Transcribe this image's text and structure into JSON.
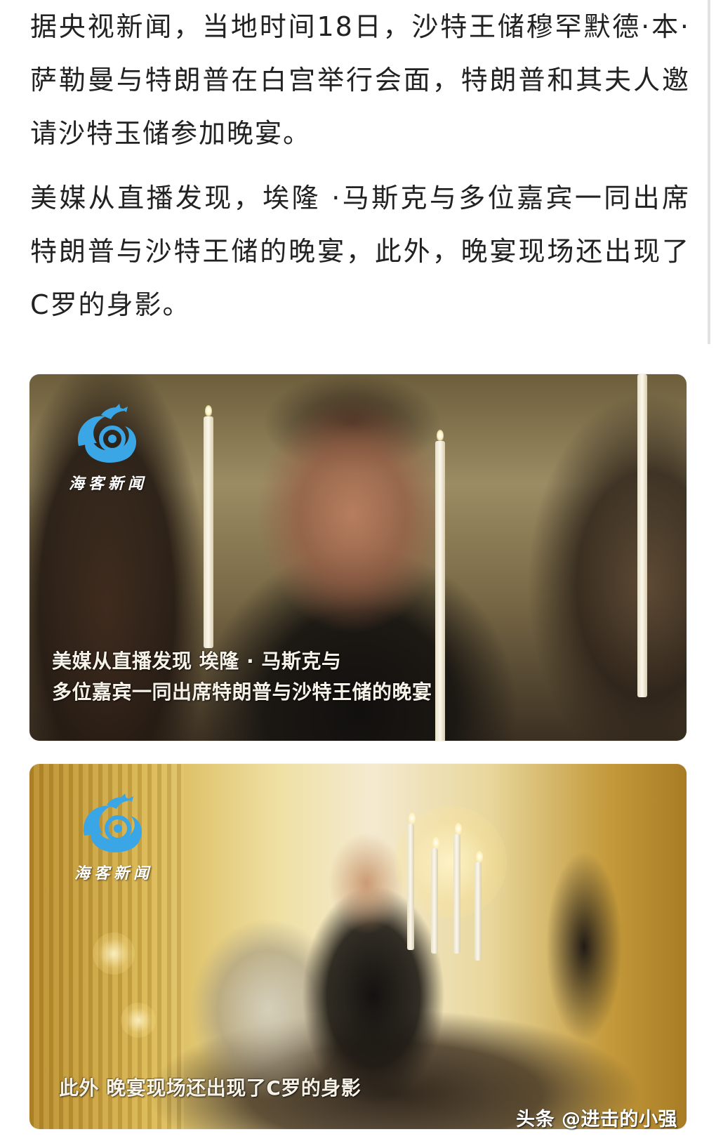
{
  "article": {
    "paragraphs": [
      "据央视新闻，当地时间18日，沙特王储穆罕默德·本·萨勒曼与特朗普在白宫举行会面，特朗普和其夫人邀请沙特玉储参加晚宴。",
      "美媒从直播发现，埃隆 ·马斯克与多位嘉宾一同出席特朗普与沙特王储的晚宴，此外，晚宴现场还出现了C罗的身影。"
    ]
  },
  "videos": [
    {
      "logo_text": "海客新闻",
      "caption_lines": [
        "美媒从直播发现 埃隆 · 马斯克与",
        "多位嘉宾一同出席特朗普与沙特王储的晚宴"
      ]
    },
    {
      "logo_text": "海客新闻",
      "caption_lines": [
        "此外 晚宴现场还出现了C罗的身影"
      ]
    }
  ],
  "watermark": "头条 @进击的小强",
  "colors": {
    "text": "#222222",
    "background": "#ffffff",
    "logo_blue": "#3aa6e6"
  },
  "icons": {
    "logo": "haike-news-logo-icon"
  }
}
